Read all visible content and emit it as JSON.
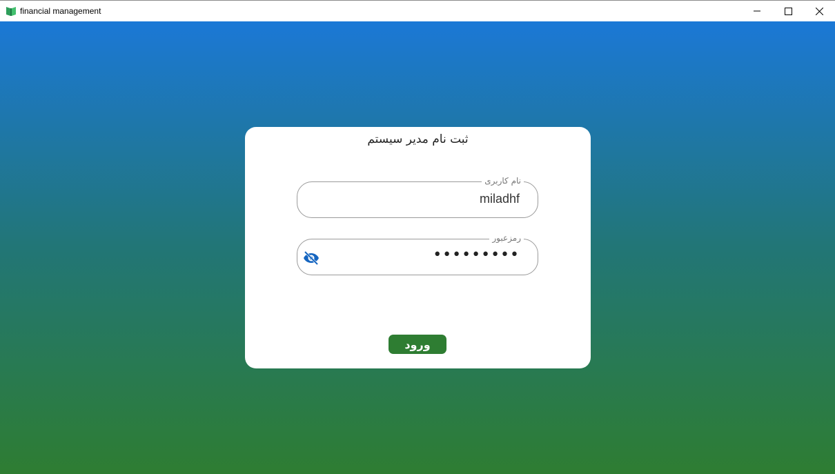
{
  "window": {
    "title": "financial management",
    "app_icon": "book-icon",
    "controls": {
      "minimize_icon": "minimize-icon",
      "maximize_icon": "maximize-icon",
      "close_icon": "close-icon"
    }
  },
  "form": {
    "title": "ثبت نام مدیر سیستم",
    "username": {
      "label": "نام کاربری",
      "value": "miladhf"
    },
    "password": {
      "label": "رمزعبور",
      "masked_value": "•••••••••",
      "toggle_icon": "eye-off-icon"
    },
    "submit_label": "ورود"
  },
  "colors": {
    "gradient_top": "#1b78d6",
    "gradient_bottom": "#2e7d32",
    "button": "#2e7d32",
    "eye_icon": "#1565c0"
  }
}
